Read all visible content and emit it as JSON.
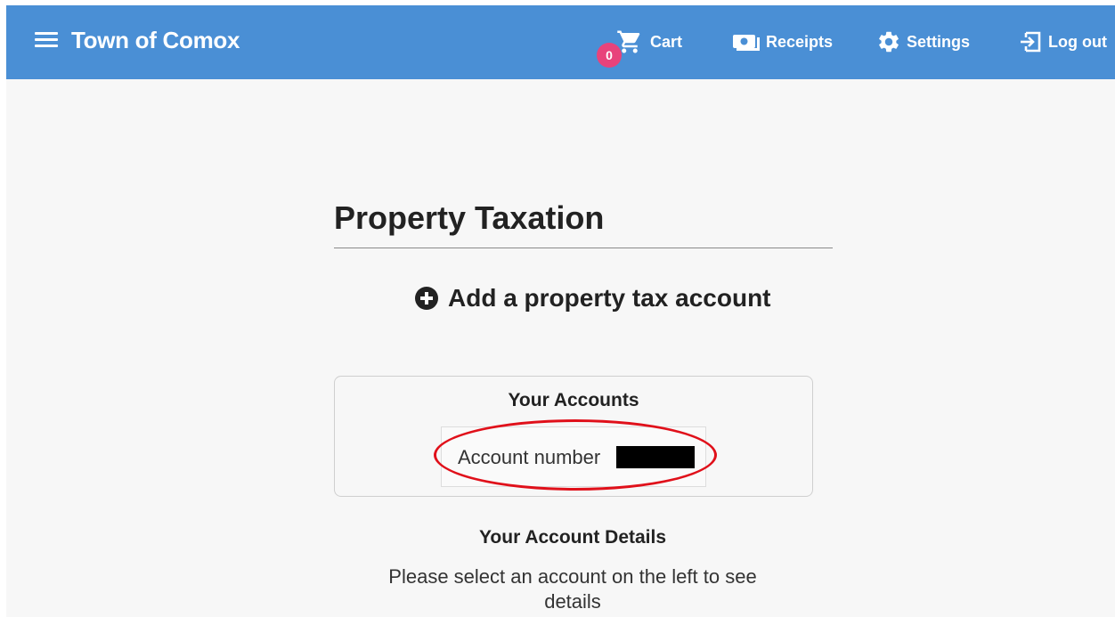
{
  "header": {
    "app_title": "Town of Comox",
    "nav": {
      "cart_label": "Cart",
      "cart_count": "0",
      "receipts_label": "Receipts",
      "settings_label": "Settings",
      "logout_label": "Log out"
    },
    "icons": [
      "menu-icon",
      "cart-icon",
      "receipts-icon",
      "gear-icon",
      "logout-icon"
    ]
  },
  "main": {
    "page_title": "Property Taxation",
    "add_account_label": "Add a property tax account",
    "accounts": {
      "heading": "Your Accounts",
      "items": [
        {
          "label": "Account number"
        }
      ]
    },
    "details": {
      "heading": "Your Account Details",
      "message": "Please select an account on the left to see details"
    }
  },
  "colors": {
    "header_bg": "#4a8fd5",
    "badge_bg": "#e8437b",
    "page_bg": "#f7f7f7",
    "annotation_oval": "#e0101a"
  }
}
